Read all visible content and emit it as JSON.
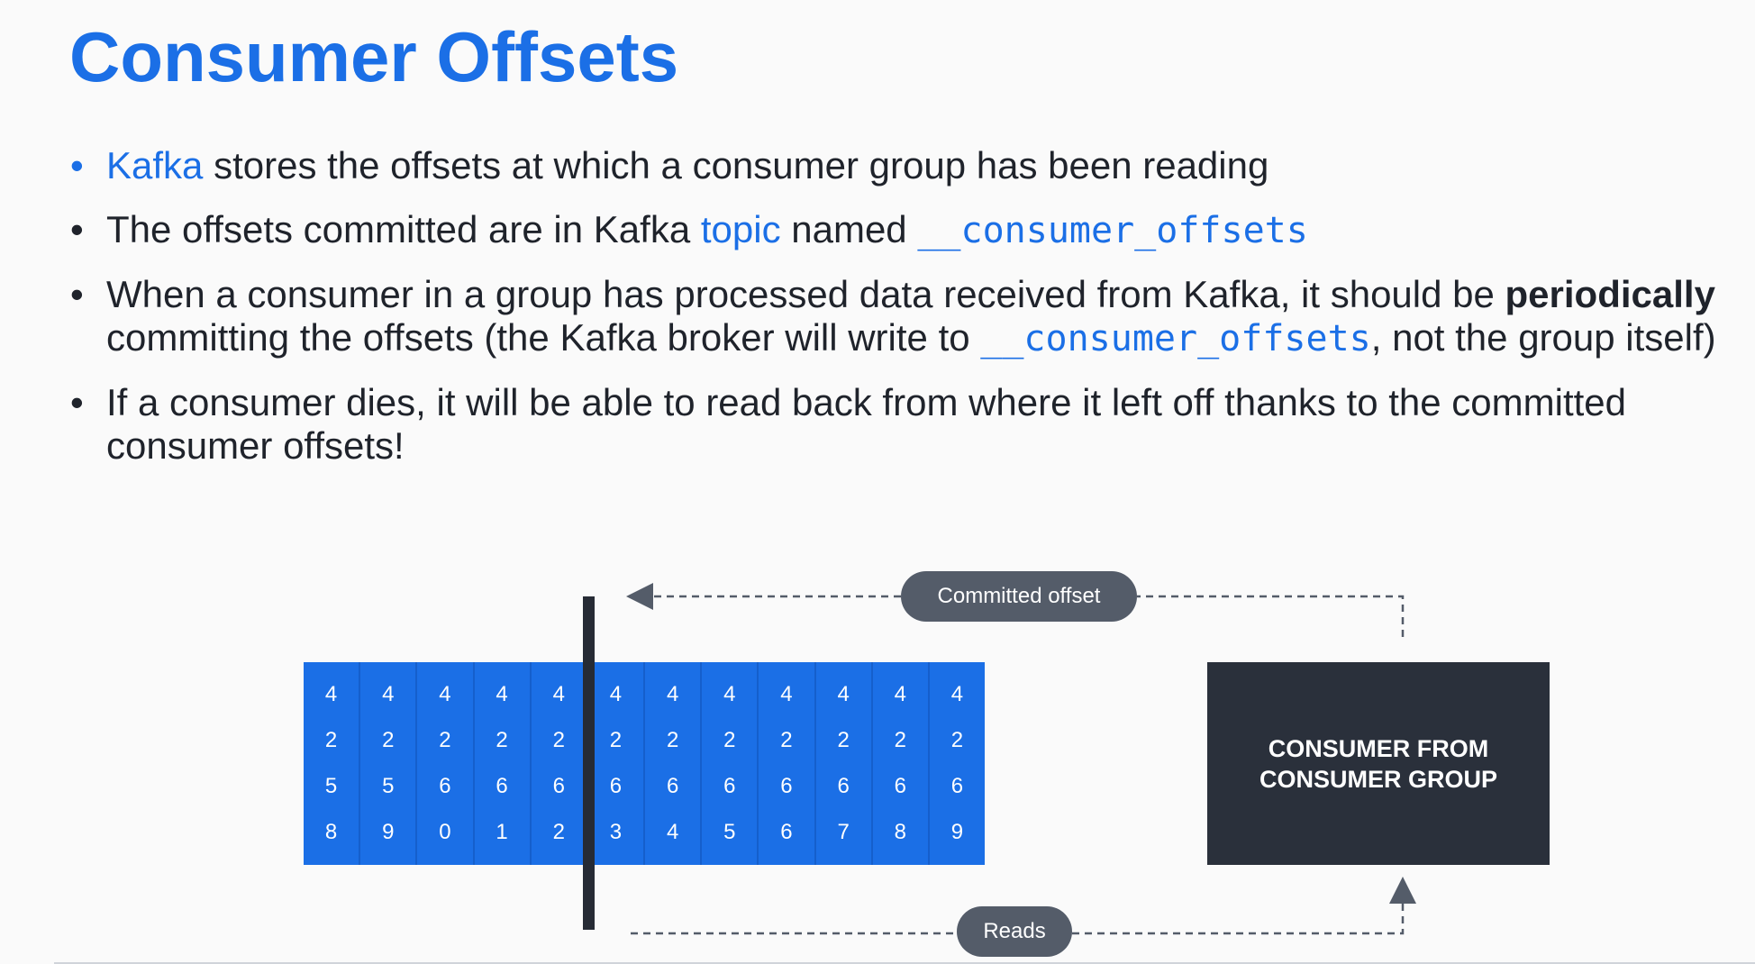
{
  "title": "Consumer Offsets",
  "bullets": {
    "b1": {
      "accent": "Kafka",
      "rest": " stores the offsets at which a consumer group has been reading"
    },
    "b2": {
      "pre": "The offsets committed are in Kafka ",
      "accent": "topic",
      "mid": " named ",
      "code": "__consumer_offsets"
    },
    "b3": {
      "pre": "When a consumer in a group has processed data received from Kafka, it should be ",
      "bold": "periodically",
      "mid": " committing the offsets (the Kafka broker will write to ",
      "code": "__consumer_offsets",
      "post": ", not the group itself)"
    },
    "b4": {
      "text": "If a consumer dies, it will be able to read back from where it left off thanks to the committed consumer offsets!"
    }
  },
  "diagram": {
    "offsets": [
      [
        "4",
        "2",
        "5",
        "8"
      ],
      [
        "4",
        "2",
        "5",
        "9"
      ],
      [
        "4",
        "2",
        "6",
        "0"
      ],
      [
        "4",
        "2",
        "6",
        "1"
      ],
      [
        "4",
        "2",
        "6",
        "2"
      ],
      [
        "4",
        "2",
        "6",
        "3"
      ],
      [
        "4",
        "2",
        "6",
        "4"
      ],
      [
        "4",
        "2",
        "6",
        "5"
      ],
      [
        "4",
        "2",
        "6",
        "6"
      ],
      [
        "4",
        "2",
        "6",
        "7"
      ],
      [
        "4",
        "2",
        "6",
        "8"
      ],
      [
        "4",
        "2",
        "6",
        "9"
      ]
    ],
    "committed_label": "Committed offset",
    "reads_label": "Reads",
    "consumer_label": "CONSUMER FROM CONSUMER GROUP",
    "colors": {
      "partition": "#1b6fe6",
      "consumer": "#2a303b",
      "pill": "#545c69",
      "accent": "#1b6fe6"
    }
  }
}
